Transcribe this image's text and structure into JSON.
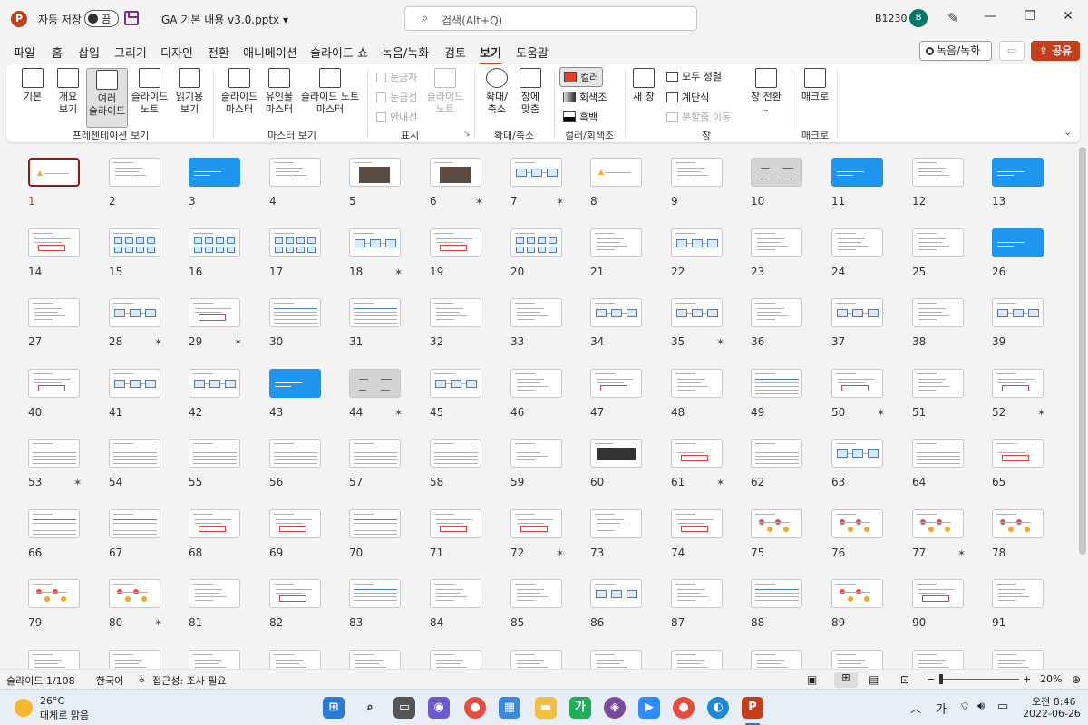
{
  "titlebar": {
    "app_logo": "P",
    "autosave_label": "자동 저장",
    "autosave_state": "끔",
    "doc_title": "GA 기본 내용 v3.0.pptx ▾",
    "search_placeholder": "검색(Alt+Q)",
    "user_name": "B1230",
    "avatar_initial": "B",
    "minimize": "—",
    "restore": "❐",
    "close": "✕"
  },
  "menu": {
    "tabs": [
      "파일",
      "홈",
      "삽입",
      "그리기",
      "디자인",
      "전환",
      "애니메이션",
      "슬라이드 쇼",
      "녹음/녹화",
      "검토",
      "보기",
      "도움말"
    ],
    "active_tab": "보기",
    "record_label": "녹음/녹화",
    "share_label": "공유"
  },
  "ribbon": {
    "presentation_views": {
      "label": "프레젠테이션 보기",
      "items": [
        "기본",
        "개요\n보기",
        "여러\n슬라이드",
        "슬라이드\n노트",
        "읽기용\n보기"
      ],
      "selected": "여러\n슬라이드"
    },
    "master_views": {
      "label": "마스터 보기",
      "items": [
        "슬라이드\n마스터",
        "유인물\n마스터",
        "슬라이드 노트\n마스터"
      ]
    },
    "show": {
      "label": "표시",
      "checkboxes": [
        "눈금자",
        "눈금선",
        "안내선"
      ],
      "notes": "슬라이드\n노트"
    },
    "zoom": {
      "label": "확대/축소",
      "items": [
        "확대/\n축소",
        "창에\n맞춤"
      ]
    },
    "color": {
      "label": "컬러/회색조",
      "items": [
        "컬러",
        "회색조",
        "흑백"
      ],
      "color_swatch": "#e04030"
    },
    "window": {
      "label": "창",
      "new_window": "새 창",
      "arrange_all": "모두 정렬",
      "cascade": "계단식",
      "move_split": "분할줄 이동",
      "switch_window": "창 전환"
    },
    "macro": {
      "label": "매크로",
      "item": "매크로"
    }
  },
  "slides": [
    {
      "n": "1",
      "star": false,
      "style": "title",
      "selected": true
    },
    {
      "n": "2",
      "star": false,
      "style": "list"
    },
    {
      "n": "3",
      "star": false,
      "style": "blue"
    },
    {
      "n": "4",
      "star": false,
      "style": "list"
    },
    {
      "n": "5",
      "star": false,
      "style": "photo"
    },
    {
      "n": "6",
      "star": true,
      "style": "photo"
    },
    {
      "n": "7",
      "star": true,
      "style": "diagram"
    },
    {
      "n": "8",
      "star": false,
      "style": "title"
    },
    {
      "n": "9",
      "star": false,
      "style": "list"
    },
    {
      "n": "10",
      "star": false,
      "style": "gray"
    },
    {
      "n": "11",
      "star": false,
      "style": "blue"
    },
    {
      "n": "12",
      "star": false,
      "style": "list"
    },
    {
      "n": "13",
      "star": false,
      "style": "blue"
    },
    {
      "n": "14",
      "star": false,
      "style": "red"
    },
    {
      "n": "15",
      "star": false,
      "style": "grid"
    },
    {
      "n": "16",
      "star": false,
      "style": "grid"
    },
    {
      "n": "17",
      "star": false,
      "style": "grid"
    },
    {
      "n": "18",
      "star": true,
      "style": "diagram"
    },
    {
      "n": "19",
      "star": false,
      "style": "red"
    },
    {
      "n": "20",
      "star": false,
      "style": "grid"
    },
    {
      "n": "21",
      "star": false,
      "style": "list"
    },
    {
      "n": "22",
      "star": false,
      "style": "diagram"
    },
    {
      "n": "23",
      "star": false,
      "style": "list"
    },
    {
      "n": "24",
      "star": false,
      "style": "list"
    },
    {
      "n": "25",
      "star": false,
      "style": "list"
    },
    {
      "n": "26",
      "star": false,
      "style": "blue"
    },
    {
      "n": "27",
      "star": false,
      "style": "list"
    },
    {
      "n": "28",
      "star": true,
      "style": "diagram"
    },
    {
      "n": "29",
      "star": true,
      "style": "red"
    },
    {
      "n": "30",
      "star": false,
      "style": "table"
    },
    {
      "n": "31",
      "star": false,
      "style": "table"
    },
    {
      "n": "32",
      "star": false,
      "style": "list"
    },
    {
      "n": "33",
      "star": false,
      "style": "list"
    },
    {
      "n": "34",
      "star": false,
      "style": "diagram"
    },
    {
      "n": "35",
      "star": true,
      "style": "diagram"
    },
    {
      "n": "36",
      "star": false,
      "style": "list"
    },
    {
      "n": "37",
      "star": false,
      "style": "diagram"
    },
    {
      "n": "38",
      "star": false,
      "style": "list"
    },
    {
      "n": "39",
      "star": false,
      "style": "diagram"
    },
    {
      "n": "40",
      "star": false,
      "style": "red"
    },
    {
      "n": "41",
      "star": false,
      "style": "diagram"
    },
    {
      "n": "42",
      "star": false,
      "style": "diagram"
    },
    {
      "n": "43",
      "star": false,
      "style": "blue"
    },
    {
      "n": "44",
      "star": true,
      "style": "gray"
    },
    {
      "n": "45",
      "star": false,
      "style": "diagram"
    },
    {
      "n": "46",
      "star": false,
      "style": "list"
    },
    {
      "n": "47",
      "star": false,
      "style": "red"
    },
    {
      "n": "48",
      "star": false,
      "style": "list"
    },
    {
      "n": "49",
      "star": false,
      "style": "table"
    },
    {
      "n": "50",
      "star": true,
      "style": "red"
    },
    {
      "n": "51",
      "star": false,
      "style": "list"
    },
    {
      "n": "52",
      "star": true,
      "style": "red"
    },
    {
      "n": "53",
      "star": true,
      "style": "table"
    },
    {
      "n": "54",
      "star": false,
      "style": "table"
    },
    {
      "n": "55",
      "star": false,
      "style": "table"
    },
    {
      "n": "56",
      "star": false,
      "style": "table"
    },
    {
      "n": "57",
      "star": false,
      "style": "table"
    },
    {
      "n": "58",
      "star": false,
      "style": "table"
    },
    {
      "n": "59",
      "star": false,
      "style": "list"
    },
    {
      "n": "60",
      "star": false,
      "style": "dark"
    },
    {
      "n": "61",
      "star": true,
      "style": "red"
    },
    {
      "n": "62",
      "star": false,
      "style": "table"
    },
    {
      "n": "63",
      "star": false,
      "style": "diagram"
    },
    {
      "n": "64",
      "star": false,
      "style": "table"
    },
    {
      "n": "65",
      "star": false,
      "style": "red"
    },
    {
      "n": "66",
      "star": false,
      "style": "table"
    },
    {
      "n": "67",
      "star": false,
      "style": "table"
    },
    {
      "n": "68",
      "star": false,
      "style": "red"
    },
    {
      "n": "69",
      "star": false,
      "style": "red"
    },
    {
      "n": "70",
      "star": false,
      "style": "table"
    },
    {
      "n": "71",
      "star": false,
      "style": "red"
    },
    {
      "n": "72",
      "star": true,
      "style": "red"
    },
    {
      "n": "73",
      "star": false,
      "style": "list"
    },
    {
      "n": "74",
      "star": false,
      "style": "red"
    },
    {
      "n": "75",
      "star": false,
      "style": "flow"
    },
    {
      "n": "76",
      "star": false,
      "style": "flow"
    },
    {
      "n": "77",
      "star": true,
      "style": "flow"
    },
    {
      "n": "78",
      "star": false,
      "style": "flow"
    },
    {
      "n": "79",
      "star": false,
      "style": "flow"
    },
    {
      "n": "80",
      "star": true,
      "style": "flow"
    },
    {
      "n": "81",
      "star": false,
      "style": "list"
    },
    {
      "n": "82",
      "star": false,
      "style": "red"
    },
    {
      "n": "83",
      "star": false,
      "style": "table"
    },
    {
      "n": "84",
      "star": false,
      "style": "list"
    },
    {
      "n": "85",
      "star": false,
      "style": "list"
    },
    {
      "n": "86",
      "star": false,
      "style": "diagram"
    },
    {
      "n": "87",
      "star": false,
      "style": "list"
    },
    {
      "n": "88",
      "star": false,
      "style": "table"
    },
    {
      "n": "89",
      "star": false,
      "style": "flow"
    },
    {
      "n": "90",
      "star": false,
      "style": "red"
    },
    {
      "n": "91",
      "star": false,
      "style": "list"
    },
    {
      "n": "",
      "star": false,
      "style": "list"
    },
    {
      "n": "",
      "star": false,
      "style": "list"
    },
    {
      "n": "",
      "star": false,
      "style": "list"
    },
    {
      "n": "",
      "star": false,
      "style": "list"
    },
    {
      "n": "",
      "star": false,
      "style": "list"
    },
    {
      "n": "",
      "star": false,
      "style": "list"
    },
    {
      "n": "",
      "star": false,
      "style": "list"
    },
    {
      "n": "",
      "star": false,
      "style": "list"
    },
    {
      "n": "",
      "star": false,
      "style": "list"
    },
    {
      "n": "",
      "star": false,
      "style": "list"
    },
    {
      "n": "",
      "star": false,
      "style": "list"
    },
    {
      "n": "",
      "star": false,
      "style": "list"
    },
    {
      "n": "",
      "star": false,
      "style": "list"
    }
  ],
  "statusbar": {
    "slide_count": "슬라이드 1/108",
    "language": "한국어",
    "accessibility": "접근성: 조사 필요",
    "zoom_minus": "−",
    "zoom_plus": "+",
    "zoom_percent": "20%"
  },
  "taskbar": {
    "weather_temp": "26°C",
    "weather_desc": "대체로 맑음",
    "ime": "가",
    "time": "오전 8:46",
    "date": "2022-06-26"
  },
  "colors": {
    "accent": "#c43e1c",
    "slide_blue": "#1e96f0",
    "selected_border": "#8b1a1a"
  }
}
